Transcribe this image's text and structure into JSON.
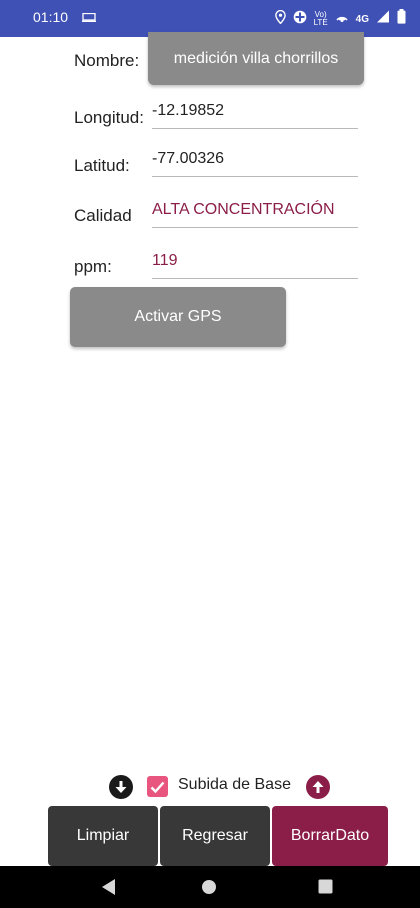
{
  "status_bar": {
    "time": "01:10",
    "volte_top": "Vo)",
    "volte_bottom": "LTE",
    "network": "4G",
    "color": "#3f51b5"
  },
  "form": {
    "nombre_label": "Nombre:",
    "nombre_value": "medición villa chorrillos",
    "longitud_label": "Longitud:",
    "longitud_value": "-12.19852",
    "latitud_label": "Latitud:",
    "latitud_value": "-77.00326",
    "calidad_label": "Calidad",
    "calidad_value": "ALTA CONCENTRACIÓN",
    "ppm_label": "ppm:",
    "ppm_value": "119",
    "accent_color": "#8b1e48"
  },
  "gps_button": {
    "label": "Activar GPS"
  },
  "upload": {
    "checkbox_label": "Subida de Base",
    "checked": true,
    "left_icon": "arrow-down-circle-icon",
    "right_icon": "arrow-up-circle-icon"
  },
  "actions": {
    "clear_label": "Limpiar",
    "back_label": "Regresar",
    "delete_label": "BorrarDato"
  },
  "nav_bar": {
    "icons": [
      "back-triangle-icon",
      "home-circle-icon",
      "recents-square-icon"
    ]
  }
}
